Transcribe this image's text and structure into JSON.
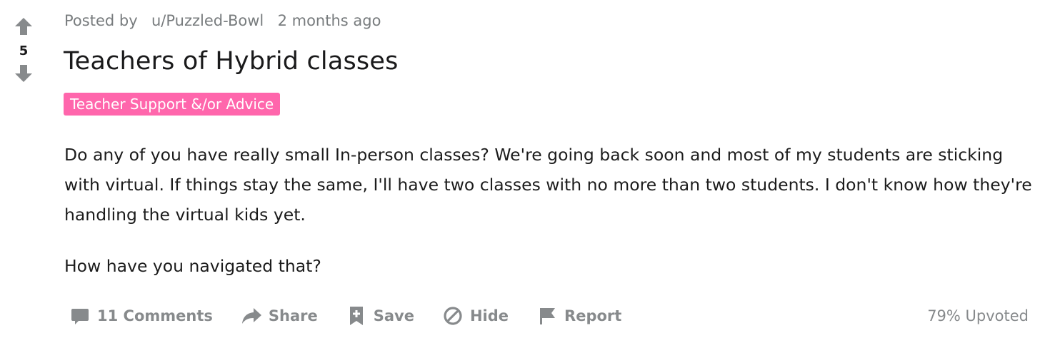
{
  "post": {
    "vote": {
      "upvote_icon": "arrow-up-icon",
      "downvote_icon": "arrow-down-icon",
      "score": "5"
    },
    "meta": {
      "posted_by": "Posted by",
      "author": "u/Puzzled-Bowl",
      "time": "2 months ago"
    },
    "title": "Teachers of Hybrid classes",
    "flair": {
      "label": "Teacher Support &/or Advice",
      "color": "#ff66ac"
    },
    "body": {
      "paragraphs": [
        "Do any of you have really small In-person classes? We're going back soon and most of my students are sticking with virtual. If things stay the same, I'll have two classes with no more than two students. I don't know how they're handling the virtual kids yet.",
        "How have you navigated that?"
      ]
    },
    "actions": {
      "comments": {
        "label": "11 Comments",
        "icon": "comment-icon"
      },
      "share": {
        "label": "Share",
        "icon": "share-icon"
      },
      "save": {
        "label": "Save",
        "icon": "bookmark-plus-icon"
      },
      "hide": {
        "label": "Hide",
        "icon": "hide-icon"
      },
      "report": {
        "label": "Report",
        "icon": "flag-icon"
      }
    },
    "upvote_ratio": "79% Upvoted"
  },
  "colors": {
    "muted_text": "#878a8c",
    "meta_text": "#787c7e",
    "primary_text": "#1a1a1b",
    "flair_bg": "#ff66ac",
    "icon_gray": "#878a8c"
  }
}
